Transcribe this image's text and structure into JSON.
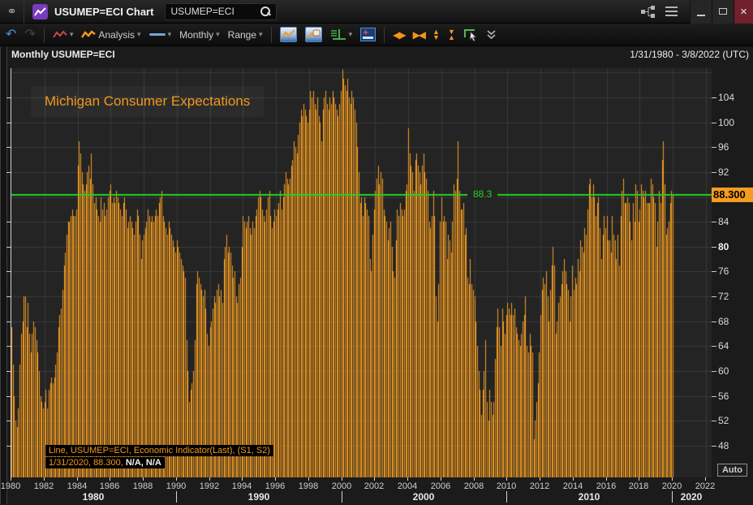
{
  "window": {
    "title": "USUMEP=ECI Chart",
    "search_value": "USUMEP=ECI"
  },
  "toolbar": {
    "analysis_label": "Analysis",
    "interval_label": "Monthly",
    "range_label": "Range"
  },
  "header": {
    "instrument": "Monthly USUMEP=ECI",
    "date_range": "1/31/1980 - 3/8/2022 (UTC)"
  },
  "chart": {
    "title": "Michigan Consumer Expectations",
    "hline_label": "88.3",
    "axis_badge": "88.300",
    "auto_label": "Auto",
    "tooltip_line1": "Line, USUMEP=ECI, Economic Indicator(Last), (S1, S2)",
    "tooltip_line2_orange": "1/31/2020, 88.300,",
    "tooltip_line2_white": "N/A, N/A",
    "colors": {
      "bar": "#f49c20",
      "hline": "#22d322",
      "grid": "#3a3a3a",
      "plot_bg": "#242424",
      "badge_bg": "#f49c20",
      "title_text": "#f2991e"
    }
  },
  "icons": {
    "link": "⚭",
    "undo": "↶",
    "redo": "↷",
    "caret": "▾",
    "close": "×",
    "expand_h": "◀▶",
    "compress_h": "▶◀",
    "tri_up": "▲",
    "tri_down": "▼"
  },
  "chart_data": {
    "type": "bar",
    "title": "Michigan Consumer Expectations",
    "series_name": "USUMEP=ECI",
    "interval": "monthly",
    "start_year": 1980,
    "x_range": [
      1980,
      2022.35
    ],
    "ylim": [
      42.9,
      108.7
    ],
    "hline": 88.3,
    "last_point": {
      "date": "1/31/2020",
      "value": 88.3
    },
    "y_ticks": [
      104,
      100,
      96,
      92,
      84,
      80,
      76,
      72,
      68,
      64,
      60,
      56,
      52,
      48
    ],
    "y_grid": [
      48,
      52,
      56,
      60,
      64,
      68,
      72,
      76,
      80,
      84,
      88,
      92,
      96,
      100,
      104,
      108
    ],
    "bold_y_tick": 80,
    "x_ticks": [
      1980,
      1982,
      1984,
      1986,
      1988,
      1990,
      1992,
      1994,
      1996,
      1998,
      2000,
      2002,
      2004,
      2006,
      2008,
      2010,
      2012,
      2014,
      2016,
      2018,
      2020,
      2022
    ],
    "decade_boundaries": [
      1990,
      2000,
      2010,
      2020
    ],
    "decade_labels": [
      "1980",
      "1990",
      "2000",
      "2010",
      "2020"
    ],
    "values": [
      67,
      61,
      56,
      52,
      51,
      54,
      61,
      66,
      68,
      72,
      72,
      67,
      71,
      66,
      63,
      66,
      68,
      67,
      65,
      63,
      60,
      56,
      55,
      54,
      55,
      57,
      54,
      57,
      58,
      59,
      58,
      59,
      61,
      63,
      67,
      69,
      70,
      73,
      77,
      79,
      82,
      84,
      84,
      85,
      86,
      85,
      85,
      86,
      93,
      97,
      95,
      92,
      90,
      89,
      90,
      92,
      93,
      91,
      95,
      90,
      87,
      88,
      86,
      85,
      84,
      88,
      86,
      87,
      85,
      86,
      88,
      89,
      90,
      87,
      88,
      87,
      89,
      88,
      87,
      86,
      85,
      87,
      88,
      86,
      83,
      84,
      85,
      84,
      83,
      82,
      84,
      86,
      85,
      82,
      78,
      81,
      82,
      83,
      84,
      86,
      85,
      84,
      85,
      84,
      85,
      86,
      85,
      87,
      88,
      89,
      85,
      84,
      83,
      82,
      84,
      83,
      82,
      81,
      80,
      79,
      81,
      80,
      79,
      78,
      77,
      76,
      75,
      65,
      60,
      55,
      57,
      58,
      60,
      65,
      74,
      76,
      75,
      74,
      73,
      72,
      73,
      70,
      66,
      64,
      67,
      68,
      70,
      72,
      71,
      73,
      74,
      72,
      73,
      71,
      78,
      80,
      82,
      79,
      80,
      79,
      77,
      75,
      76,
      72,
      71,
      74,
      75,
      80,
      85,
      84,
      83,
      84,
      85,
      83,
      82,
      84,
      83,
      85,
      86,
      88,
      89,
      88,
      86,
      85,
      84,
      86,
      88,
      89,
      85,
      83,
      84,
      86,
      85,
      86,
      87,
      89,
      86,
      88,
      90,
      92,
      91,
      90,
      91,
      93,
      94,
      97,
      96,
      95,
      98,
      100,
      102,
      101,
      103,
      102,
      101,
      100,
      102,
      105,
      104,
      105,
      103,
      102,
      104,
      101,
      100,
      97,
      102,
      104,
      105,
      103,
      102,
      104,
      103,
      105,
      104,
      103,
      102,
      101,
      103,
      105,
      108.5,
      107,
      106,
      105,
      107,
      104,
      103,
      105,
      104,
      102,
      100,
      96,
      92,
      87,
      88,
      85,
      88,
      87,
      86,
      85,
      78,
      76,
      82,
      86,
      89,
      91,
      93,
      90,
      92,
      91,
      86,
      85,
      84,
      81,
      83,
      84,
      80,
      76,
      75,
      81,
      86,
      85,
      87,
      86,
      85,
      86,
      89,
      90,
      99,
      95,
      93,
      92,
      89,
      94,
      95,
      93,
      92,
      90,
      93,
      95,
      92,
      91,
      89,
      84,
      83,
      85,
      89,
      85,
      72,
      68,
      74,
      84,
      88,
      84,
      85,
      84,
      78,
      82,
      81,
      79,
      84,
      90,
      89,
      91,
      97,
      89,
      86,
      86,
      87,
      82,
      83,
      75,
      74,
      78,
      74,
      73,
      72,
      68,
      64,
      60,
      57,
      53,
      57,
      60,
      65,
      55,
      52,
      57,
      55,
      53,
      55,
      62,
      67,
      70,
      67,
      64,
      70,
      68,
      66,
      69,
      71,
      70,
      69,
      71,
      69,
      70,
      67,
      66,
      65,
      64,
      66,
      68,
      69,
      72,
      64,
      63,
      66,
      64,
      63,
      49,
      52,
      55,
      58,
      63,
      69,
      73,
      75,
      74,
      76,
      72,
      68,
      73,
      77,
      80,
      77,
      66,
      68,
      71,
      72,
      74,
      76,
      78,
      76,
      74,
      73,
      68,
      72,
      77,
      73,
      75,
      74,
      78,
      76,
      81,
      80,
      79,
      83,
      82,
      86,
      90,
      91,
      88,
      90,
      88,
      85,
      87,
      88,
      83,
      78,
      82,
      85,
      83,
      85,
      81,
      81,
      79,
      85,
      82,
      81,
      78,
      82,
      77,
      85,
      89,
      91,
      87,
      87,
      88,
      87,
      84,
      81,
      87,
      84,
      90,
      89,
      84,
      86,
      90,
      89,
      88,
      89,
      87,
      87,
      87,
      91,
      90,
      88,
      87,
      80,
      84,
      89,
      87,
      94,
      97,
      90,
      82,
      83,
      84,
      87,
      89,
      88.3
    ]
  }
}
